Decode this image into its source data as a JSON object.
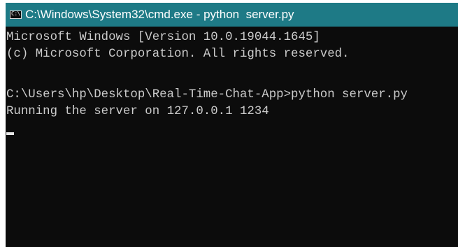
{
  "window": {
    "title": "C:\\Windows\\System32\\cmd.exe - python  server.py",
    "icon": "cmd-icon",
    "icon_text": "C:\\"
  },
  "console": {
    "lines": [
      "Microsoft Windows [Version 10.0.19044.1645]",
      "(c) Microsoft Corporation. All rights reserved.",
      "",
      "C:\\Users\\hp\\Desktop\\Real-Time-Chat-App>python server.py",
      "Running the server on 127.0.0.1 1234"
    ]
  },
  "colors": {
    "titlebar": "#1e7a86",
    "console_bg": "#0c0c0c",
    "console_text": "#cccccc"
  }
}
